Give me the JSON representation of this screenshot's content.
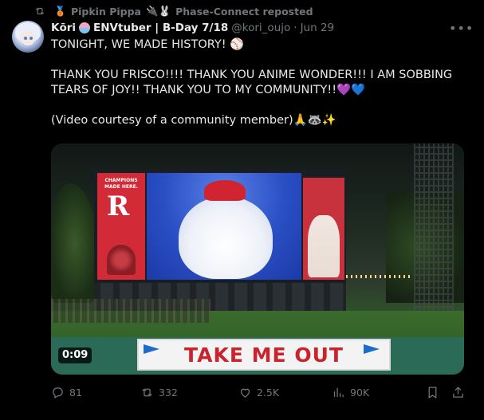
{
  "repost_bar": {
    "medal": "🥉",
    "reposted_by": "Pipkin Pippa",
    "emoji_tail": "🔌🐰",
    "label": "Phase-Connect reposted"
  },
  "post": {
    "display_name": "Kōri",
    "display_name_tail": "ENVtuber | B-Day 7/18",
    "handle": "@kori_oujo",
    "dot": "·",
    "date": "Jun 29",
    "text_lines": [
      "TONIGHT, WE MADE HISTORY! ⚾",
      "THANK YOU FRISCO!!!! THANK YOU ANIME WONDER!!! I AM SOBBING TEARS OF JOY!! THANK YOU TO MY COMMUNITY!!💜💙",
      "(Video courtesy of a community member)🙏🦝✨"
    ]
  },
  "video": {
    "duration": "0:09",
    "banner_text": "TAKE ME OUT",
    "scoreboard_left_text": "CHAMPIONS MADE HERE."
  },
  "actions": {
    "replies": "81",
    "reposts": "332",
    "likes": "2.5K",
    "views": "90K"
  },
  "icons": {
    "repost_bar": "repost-icon",
    "more": "more-icon",
    "reply": "reply-icon",
    "repost": "repost-icon",
    "like": "heart-icon",
    "views": "views-icon",
    "bookmark": "bookmark-icon",
    "share": "share-icon"
  },
  "colors": {
    "background": "#000000",
    "muted": "#71767b",
    "text": "#e7e9ea",
    "banner_red": "#c8242e"
  }
}
